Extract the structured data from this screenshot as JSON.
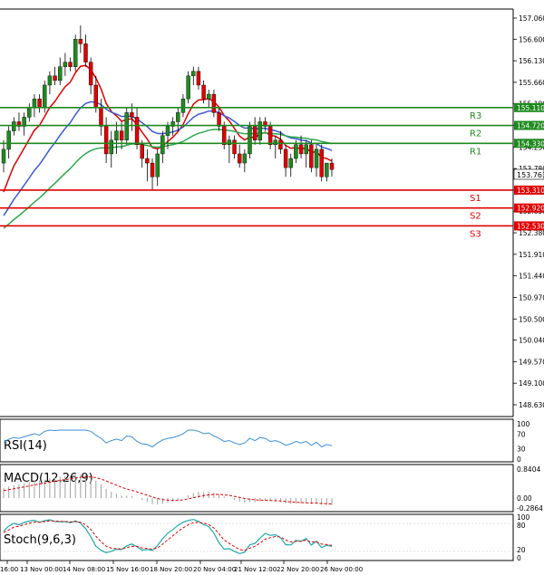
{
  "chart_data": {
    "type": "candlestick",
    "title": "",
    "price_axis": {
      "ticks": [
        "157.060",
        "156.600",
        "156.130",
        "155.660",
        "155.190",
        "154.720",
        "154.250",
        "153.780",
        "153.310",
        "152.850",
        "152.380",
        "151.910",
        "151.440",
        "150.970",
        "150.500",
        "150.040",
        "149.570",
        "149.100",
        "148.630"
      ],
      "range": [
        148.63,
        157.2
      ],
      "current_price": "153.763"
    },
    "time_axis": [
      "16:00",
      "13 Nov 00:00",
      "14 Nov 08:00",
      "15 Nov 16:00",
      "18 Nov 20:00",
      "20 Nov 04:00",
      "21 Nov 12:00",
      "22 Nov 20:00",
      "26 Nov 00:00"
    ],
    "levels": [
      {
        "name": "R3",
        "value": "155.110",
        "price": 155.11,
        "color": "#1f8a1f"
      },
      {
        "name": "R2",
        "value": "154.720",
        "price": 154.72,
        "color": "#1f8a1f"
      },
      {
        "name": "R1",
        "value": "154.330",
        "price": 154.33,
        "color": "#1f8a1f"
      },
      {
        "name": "S1",
        "value": "153.310",
        "price": 153.31,
        "color": "#e00000"
      },
      {
        "name": "S2",
        "value": "152.920",
        "price": 152.92,
        "color": "#e00000"
      },
      {
        "name": "S3",
        "value": "152.530",
        "price": 152.53,
        "color": "#e00000"
      }
    ],
    "candles_ohlc": [
      [
        153.9,
        154.4,
        153.7,
        154.2
      ],
      [
        154.2,
        154.7,
        154.0,
        154.6
      ],
      [
        154.6,
        154.9,
        154.5,
        154.8
      ],
      [
        154.8,
        155.0,
        154.6,
        154.7
      ],
      [
        154.7,
        155.0,
        154.5,
        154.9
      ],
      [
        154.9,
        155.2,
        154.8,
        155.1
      ],
      [
        155.1,
        155.4,
        154.9,
        155.3
      ],
      [
        155.3,
        155.4,
        155.0,
        155.1
      ],
      [
        155.1,
        155.7,
        155.0,
        155.6
      ],
      [
        155.6,
        155.9,
        155.4,
        155.8
      ],
      [
        155.8,
        156.0,
        155.6,
        155.7
      ],
      [
        155.7,
        156.2,
        155.6,
        156.0
      ],
      [
        156.0,
        156.3,
        155.8,
        156.1
      ],
      [
        156.1,
        156.2,
        155.9,
        156.0
      ],
      [
        156.0,
        156.7,
        155.9,
        156.6
      ],
      [
        156.6,
        156.9,
        156.3,
        156.5
      ],
      [
        156.5,
        156.7,
        156.0,
        156.1
      ],
      [
        156.1,
        156.2,
        155.4,
        155.6
      ],
      [
        155.6,
        155.8,
        155.0,
        155.1
      ],
      [
        155.1,
        155.3,
        154.5,
        154.7
      ],
      [
        154.7,
        154.9,
        153.9,
        154.1
      ],
      [
        154.1,
        154.6,
        153.8,
        154.4
      ],
      [
        154.4,
        154.8,
        154.1,
        154.6
      ],
      [
        154.6,
        154.8,
        154.2,
        154.4
      ],
      [
        154.4,
        155.1,
        154.3,
        155.0
      ],
      [
        155.0,
        155.2,
        154.6,
        154.9
      ],
      [
        154.9,
        155.1,
        154.2,
        154.3
      ],
      [
        154.3,
        154.4,
        153.8,
        154.0
      ],
      [
        154.0,
        154.2,
        153.5,
        153.9
      ],
      [
        153.9,
        154.0,
        153.3,
        153.6
      ],
      [
        153.6,
        154.2,
        153.4,
        154.1
      ],
      [
        154.1,
        154.6,
        153.9,
        154.5
      ],
      [
        154.5,
        154.8,
        154.2,
        154.7
      ],
      [
        154.7,
        154.9,
        154.5,
        154.8
      ],
      [
        154.8,
        155.1,
        154.6,
        155.0
      ],
      [
        155.0,
        155.4,
        154.9,
        155.3
      ],
      [
        155.3,
        155.9,
        155.2,
        155.8
      ],
      [
        155.8,
        156.0,
        155.6,
        155.9
      ],
      [
        155.9,
        156.0,
        155.5,
        155.6
      ],
      [
        155.6,
        155.7,
        155.2,
        155.3
      ],
      [
        155.3,
        155.5,
        155.1,
        155.4
      ],
      [
        155.4,
        155.5,
        154.9,
        155.0
      ],
      [
        155.0,
        155.1,
        154.6,
        154.7
      ],
      [
        154.7,
        154.8,
        154.2,
        154.3
      ],
      [
        154.3,
        154.5,
        153.9,
        154.4
      ],
      [
        154.4,
        154.5,
        154.0,
        154.1
      ],
      [
        154.1,
        154.3,
        153.8,
        153.9
      ],
      [
        153.9,
        154.2,
        153.7,
        154.1
      ],
      [
        154.1,
        154.8,
        154.0,
        154.7
      ],
      [
        154.7,
        154.9,
        154.3,
        154.4
      ],
      [
        154.4,
        154.9,
        154.3,
        154.8
      ],
      [
        154.8,
        154.9,
        154.6,
        154.7
      ],
      [
        154.7,
        154.8,
        154.2,
        154.3
      ],
      [
        154.3,
        154.5,
        154.0,
        154.4
      ],
      [
        154.4,
        154.6,
        154.1,
        154.2
      ],
      [
        154.2,
        154.3,
        153.6,
        153.8
      ],
      [
        153.8,
        154.1,
        153.6,
        154.0
      ],
      [
        154.0,
        154.4,
        153.9,
        154.3
      ],
      [
        154.3,
        154.5,
        154.0,
        154.1
      ],
      [
        154.1,
        154.4,
        153.8,
        154.3
      ],
      [
        154.3,
        154.4,
        153.7,
        153.8
      ],
      [
        153.8,
        154.3,
        153.6,
        154.2
      ],
      [
        154.2,
        154.3,
        153.5,
        153.6
      ],
      [
        153.6,
        153.9,
        153.5,
        153.9
      ],
      [
        153.9,
        154.0,
        153.6,
        153.76
      ]
    ],
    "series": [
      {
        "name": "",
        "color": "#e00000"
      },
      {
        "name": "",
        "color": "#3a5bd9"
      },
      {
        "name": "",
        "color": "#2ea84a"
      }
    ],
    "indicators": [
      {
        "label": "RSI(14)",
        "ticks": [
          "100",
          "70",
          "30",
          "0"
        ],
        "range": [
          0,
          100
        ],
        "color": "#3b8ed8"
      },
      {
        "label": "MACD(12,26,9)",
        "ticks": [
          "0.8404",
          "0.00",
          "-0.2864"
        ],
        "range": [
          -0.2864,
          0.8404
        ],
        "histogram_color": "#a0a0a0",
        "signal_color": "#e00000"
      },
      {
        "label": "Stoch(9,6,3)",
        "ticks": [
          "100",
          "80",
          "20",
          "0"
        ],
        "range": [
          0,
          100
        ],
        "main_color": "#20a8a8",
        "signal_color": "#e00000"
      }
    ]
  }
}
